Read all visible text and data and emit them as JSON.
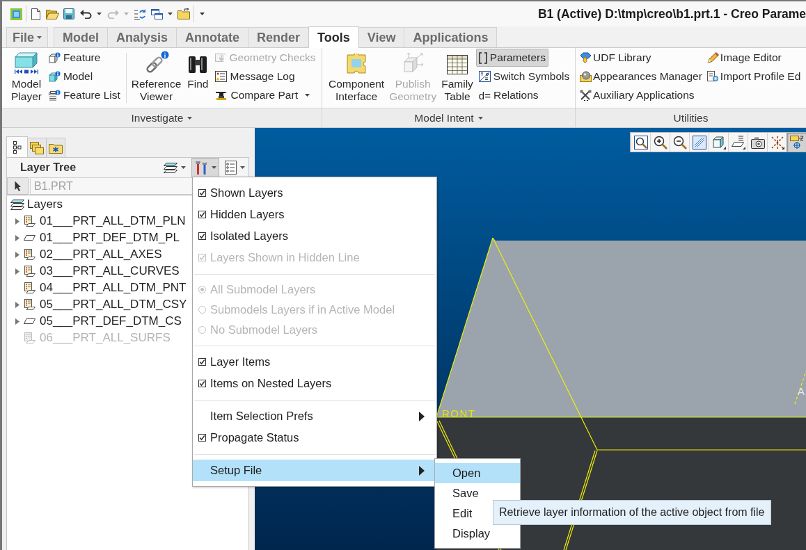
{
  "window": {
    "title": "B1 (Active) D:\\tmp\\creo\\b1.prt.1 - Creo Parame"
  },
  "quick_access_toolbar": [
    {
      "disabled": false,
      "dropdown": false
    },
    {
      "disabled": false,
      "dropdown": false
    },
    {
      "disabled": false,
      "dropdown": false
    },
    {
      "disabled": false,
      "dropdown": true
    },
    {
      "disabled": true,
      "dropdown": true
    },
    {
      "disabled": false,
      "dropdown": false
    },
    {
      "disabled": false,
      "dropdown": true
    },
    {
      "disabled": false,
      "dropdown": false
    }
  ],
  "ribbon_tabs": [
    {
      "label": "File",
      "kind": "menu",
      "selected": false
    },
    {
      "label": "Model",
      "kind": "tab",
      "selected": false
    },
    {
      "label": "Analysis",
      "kind": "tab",
      "selected": false
    },
    {
      "label": "Annotate",
      "kind": "tab",
      "selected": false
    },
    {
      "label": "Render",
      "kind": "tab",
      "selected": false
    },
    {
      "label": "Tools",
      "kind": "tab",
      "selected": true
    },
    {
      "label": "View",
      "kind": "tab",
      "selected": false
    },
    {
      "label": "Applications",
      "kind": "tab",
      "selected": false
    }
  ],
  "ribbon_groups": [
    {
      "label": "Investigate",
      "dropdown": true,
      "controls": [
        {
          "kind": "large",
          "label": "Model Player",
          "disabled": false
        },
        {
          "kind": "stack",
          "items": [
            {
              "label": "Feature",
              "disabled": false,
              "pressed": false,
              "dropdown": false
            },
            {
              "label": "Model",
              "disabled": false,
              "pressed": false,
              "dropdown": false
            },
            {
              "label": "Feature List",
              "disabled": false,
              "pressed": false,
              "dropdown": false
            }
          ]
        },
        {
          "kind": "separator"
        },
        {
          "kind": "large",
          "label": "Reference Viewer",
          "disabled": false
        },
        {
          "kind": "large",
          "label": "Find",
          "disabled": false
        },
        {
          "kind": "stack",
          "items": [
            {
              "label": "Geometry Checks",
              "disabled": true,
              "pressed": false,
              "dropdown": false
            },
            {
              "label": "Message Log",
              "disabled": false,
              "pressed": false,
              "dropdown": false
            },
            {
              "label": "Compare Part",
              "disabled": false,
              "pressed": false,
              "dropdown": true
            }
          ]
        }
      ]
    },
    {
      "label": "Model Intent",
      "dropdown": true,
      "controls": [
        {
          "kind": "large",
          "label": "Component Interface",
          "disabled": false
        },
        {
          "kind": "large",
          "label": "Publish Geometry",
          "disabled": true
        },
        {
          "kind": "large",
          "label": "Family Table",
          "disabled": false
        },
        {
          "kind": "stack",
          "items": [
            {
              "label": "Parameters",
              "disabled": false,
              "pressed": true,
              "dropdown": false
            },
            {
              "label": "Switch Symbols",
              "disabled": false,
              "pressed": false,
              "dropdown": false
            },
            {
              "label": "Relations",
              "glyph": "d=",
              "disabled": false,
              "pressed": false,
              "dropdown": false
            }
          ]
        }
      ]
    },
    {
      "label": "Utilities",
      "dropdown": false,
      "controls": [
        {
          "kind": "stack",
          "items": [
            {
              "label": "UDF Library",
              "disabled": false,
              "pressed": false,
              "dropdown": false
            },
            {
              "label": "Appearances Manager",
              "disabled": false,
              "pressed": false,
              "dropdown": false
            },
            {
              "label": "Auxiliary Applications",
              "disabled": false,
              "pressed": false,
              "dropdown": false
            }
          ]
        },
        {
          "kind": "stack",
          "items": [
            {
              "label": "Image Editor",
              "disabled": false,
              "pressed": false,
              "dropdown": false
            },
            {
              "label": "Import Profile Ed",
              "disabled": false,
              "pressed": false,
              "dropdown": false
            }
          ]
        }
      ]
    }
  ],
  "navigator": {
    "tabs": [
      {
        "selected": true
      },
      {
        "selected": false
      },
      {
        "selected": false
      }
    ]
  },
  "layer_tree": {
    "title": "Layer Tree",
    "header_buttons": [
      {
        "pressed": false
      },
      {
        "pressed": true
      },
      {
        "pressed": false
      }
    ],
    "model_selector": {
      "value": "B1.PRT",
      "disabled": true
    },
    "root": {
      "label": "Layers",
      "children": [
        {
          "label": "01___PRT_ALL_DTM_PLN",
          "kind": "standard",
          "expandable": true,
          "disabled": false
        },
        {
          "label": "01___PRT_DEF_DTM_PL",
          "kind": "default",
          "expandable": true,
          "disabled": false
        },
        {
          "label": "02___PRT_ALL_AXES",
          "kind": "standard",
          "expandable": true,
          "disabled": false
        },
        {
          "label": "03___PRT_ALL_CURVES",
          "kind": "standard",
          "expandable": true,
          "disabled": false
        },
        {
          "label": "04___PRT_ALL_DTM_PNT",
          "kind": "standard",
          "expandable": false,
          "disabled": false
        },
        {
          "label": "05___PRT_ALL_DTM_CSY",
          "kind": "standard",
          "expandable": true,
          "disabled": false
        },
        {
          "label": "05___PRT_DEF_DTM_CS",
          "kind": "default",
          "expandable": true,
          "disabled": false
        },
        {
          "label": "06___PRT_ALL_SURFS",
          "kind": "standard",
          "expandable": false,
          "disabled": true
        }
      ]
    }
  },
  "layer_tree_menu": {
    "items": [
      {
        "kind": "check",
        "label": "Shown Layers",
        "checked": true,
        "disabled": false,
        "highlighted": false
      },
      {
        "kind": "check",
        "label": "Hidden Layers",
        "checked": true,
        "disabled": false,
        "highlighted": false
      },
      {
        "kind": "check",
        "label": "Isolated Layers",
        "checked": true,
        "disabled": false,
        "highlighted": false
      },
      {
        "kind": "check",
        "label": "Layers Shown in Hidden Line",
        "checked": true,
        "disabled": true,
        "highlighted": false
      },
      {
        "kind": "separator"
      },
      {
        "kind": "radio",
        "label": "All Submodel Layers",
        "selected": true,
        "disabled": true,
        "highlighted": false
      },
      {
        "kind": "radio",
        "label": "Submodels Layers if in Active Model",
        "selected": false,
        "disabled": true,
        "highlighted": false
      },
      {
        "kind": "radio",
        "label": "No Submodel Layers",
        "selected": false,
        "disabled": true,
        "highlighted": false
      },
      {
        "kind": "separator"
      },
      {
        "kind": "check",
        "label": "Layer Items",
        "checked": true,
        "disabled": false,
        "highlighted": false
      },
      {
        "kind": "check",
        "label": "Items on Nested Layers",
        "checked": true,
        "disabled": false,
        "highlighted": false
      },
      {
        "kind": "separator"
      },
      {
        "kind": "submenu",
        "label": "Item Selection Prefs",
        "disabled": false,
        "highlighted": false
      },
      {
        "kind": "check",
        "label": "Propagate Status",
        "checked": true,
        "disabled": false,
        "highlighted": false
      },
      {
        "kind": "separator"
      },
      {
        "kind": "submenu",
        "label": "Setup File",
        "disabled": false,
        "highlighted": true
      }
    ]
  },
  "setup_file_submenu": {
    "items": [
      {
        "label": "Open",
        "highlighted": true
      },
      {
        "label": "Save",
        "highlighted": false
      },
      {
        "label": "Edit",
        "highlighted": false
      },
      {
        "label": "Display",
        "highlighted": false
      }
    ]
  },
  "tooltip": {
    "text": "Retrieve layer information of the active object from file"
  },
  "viewport": {
    "toolbar": [
      {
        "pressed": false
      },
      {
        "pressed": false
      },
      {
        "pressed": false
      },
      {
        "pressed": false
      },
      {
        "pressed": false
      },
      {
        "pressed": false
      },
      {
        "pressed": false
      },
      {
        "pressed": false
      },
      {
        "pressed": true
      }
    ],
    "labels": [
      {
        "text": "RONT"
      },
      {
        "text": "A"
      }
    ]
  }
}
